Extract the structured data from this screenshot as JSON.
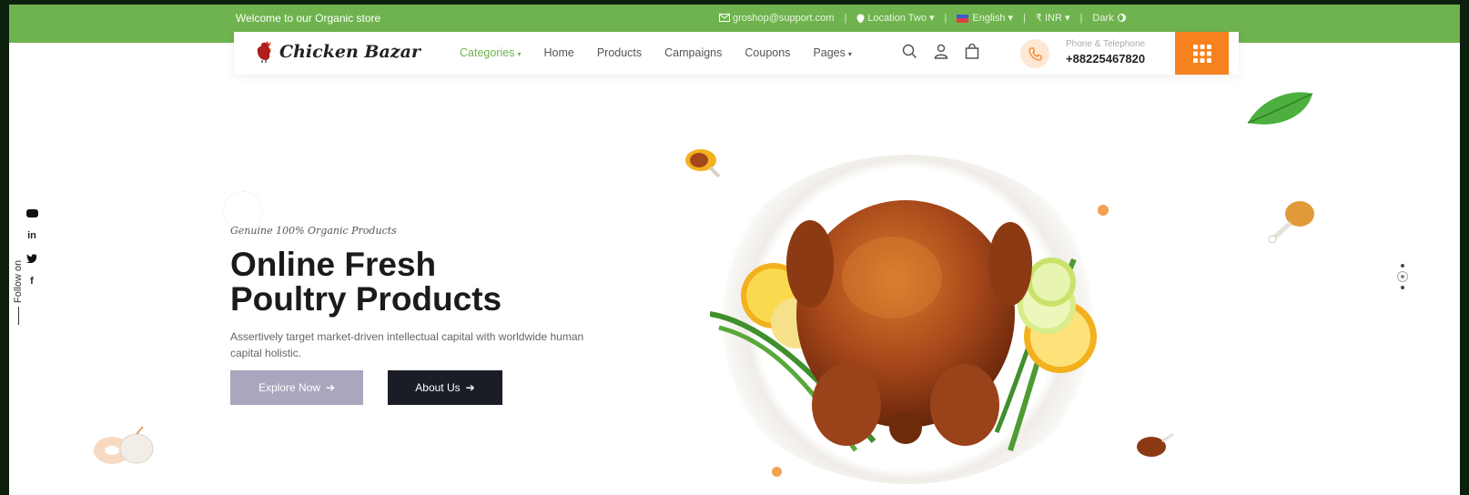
{
  "topbar": {
    "welcome": "Welcome to our Organic store",
    "email": "groshop@support.com",
    "location": "Location Two",
    "language": "English",
    "currency": "₹ INR",
    "theme": "Dark",
    "separator": "|"
  },
  "navbar": {
    "logo_text": "Chicken Bazar",
    "menu": [
      "Categories",
      "Home",
      "Products",
      "Campaigns",
      "Coupons",
      "Pages"
    ],
    "phone_label": "Phone & Telephone",
    "phone_number": "+88225467820"
  },
  "social": {
    "icons": [
      "youtube-icon",
      "linkedin-icon",
      "twitter-icon",
      "facebook-icon"
    ],
    "linkedin_text": "in",
    "facebook_text": "f",
    "follow_label": "Follow on"
  },
  "hero": {
    "tagline": "Genuine 100% Organic Products",
    "headline_line1": "Online Fresh",
    "headline_line2": "Poultry Products",
    "description": "Assertively target market-driven intellectual capital with worldwide human capital holistic.",
    "explore_button": "Explore Now",
    "about_button": "About Us"
  },
  "colors": {
    "brand_green": "#6fb34e",
    "accent_orange": "#f5811f",
    "dark": "#1a1d26",
    "muted_button": "#a9a7be"
  }
}
